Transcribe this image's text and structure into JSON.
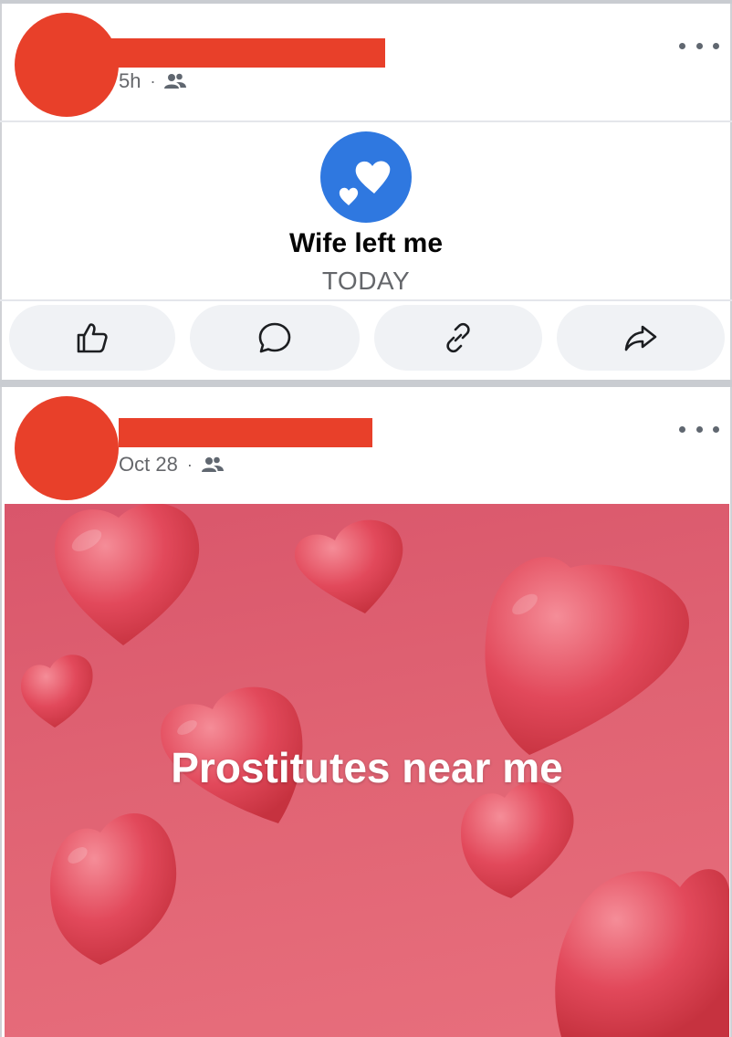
{
  "posts": [
    {
      "time": "5h",
      "separator": "·",
      "audience_icon": "friends-icon",
      "life_event": {
        "icon": "hearts-icon",
        "title": "Wife left me",
        "date": "TODAY"
      },
      "actions": [
        "like-icon",
        "comment-icon",
        "copy-link-icon",
        "share-icon"
      ]
    },
    {
      "time": "Oct 28",
      "separator": "·",
      "audience_icon": "friends-icon",
      "image_caption": "Prostitutes near me"
    }
  ],
  "colors": {
    "redaction": "#e8402a",
    "life_event_icon_bg": "#2f78e0",
    "action_button_bg": "#f0f2f5",
    "image_bg": "#e06373"
  }
}
